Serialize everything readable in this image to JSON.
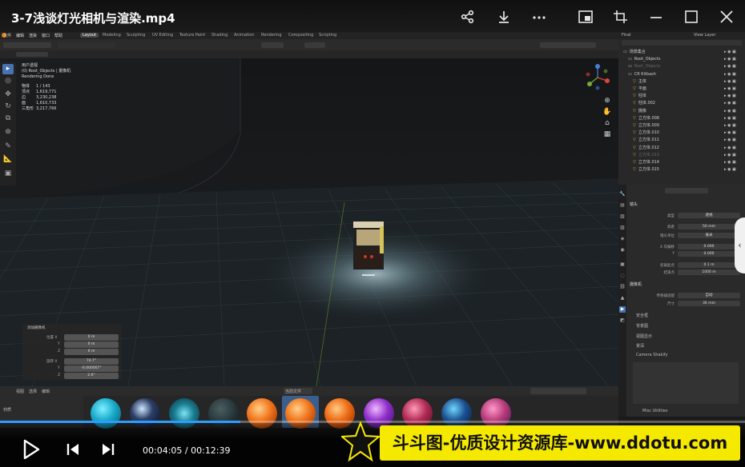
{
  "player": {
    "title": "3-7浅谈灯光相机与渲染.mp4",
    "time_current": "00:04:05",
    "time_total": "00:12:39",
    "time_separator": " / ",
    "progress": 0.323,
    "icons": [
      "share-icon",
      "download-icon",
      "more-icon",
      "picture-in-picture-icon",
      "crop-icon",
      "minimize-icon",
      "maximize-icon",
      "close-icon",
      "play-icon",
      "prev-icon",
      "next-icon"
    ]
  },
  "watermark": {
    "text": "斗斗图-优质设计资源库-www.ddotu.com"
  },
  "blender": {
    "menu": [
      "文件",
      "编辑",
      "渲染",
      "窗口",
      "帮助"
    ],
    "workspaces": [
      "Layout",
      "Modeling",
      "Sculpting",
      "UV Editing",
      "Texture Paint",
      "Shading",
      "Animation",
      "Rendering",
      "Compositing",
      "Scripting"
    ],
    "scene": "Final",
    "view_layer": "View Layer",
    "viewport_stats": {
      "view": "用户透视",
      "collection": "(0) Root_Objects | 摄像机",
      "status": "Rendering Done",
      "rows": [
        {
          "label": "物体",
          "value": "1 / 143"
        },
        {
          "label": "顶点",
          "value": "1,619,771"
        },
        {
          "label": "边",
          "value": "3,230,238"
        },
        {
          "label": "面",
          "value": "1,610,733"
        },
        {
          "label": "三角形",
          "value": "3,217,766"
        }
      ]
    },
    "redo_panel": {
      "title": "添加摄像机",
      "rows": [
        {
          "label": "位置 X",
          "value": "0 m"
        },
        {
          "label": "Y",
          "value": "0 m"
        },
        {
          "label": "Z",
          "value": "0 m"
        },
        {
          "label": "旋转 X",
          "value": "74.7°"
        },
        {
          "label": "Y",
          "value": "-0.000007°"
        },
        {
          "label": "Z",
          "value": "2.6°"
        }
      ]
    },
    "outliner": {
      "rows": [
        {
          "name": "场景集合",
          "dim": false
        },
        {
          "name": "Root_Objects",
          "dim": false
        },
        {
          "name": "Root_Objects",
          "dim": true
        },
        {
          "name": "CR Kitbash",
          "dim": false
        },
        {
          "name": "主体",
          "dim": false
        },
        {
          "name": "平面",
          "dim": false
        },
        {
          "name": "柱体",
          "dim": false
        },
        {
          "name": "柱体.002",
          "dim": false
        },
        {
          "name": "摄像",
          "dim": false
        },
        {
          "name": "立方体.008",
          "dim": false
        },
        {
          "name": "立方体.009",
          "dim": false
        },
        {
          "name": "立方体.010",
          "dim": false
        },
        {
          "name": "立方体.011",
          "dim": false
        },
        {
          "name": "立方体.012",
          "dim": false
        },
        {
          "name": "立方体.013",
          "dim": true
        },
        {
          "name": "立方体.014",
          "dim": false
        },
        {
          "name": "立方体.015",
          "dim": false
        }
      ]
    },
    "properties": {
      "section_lens": "镜头",
      "fields": [
        {
          "label": "类型",
          "value": "透视"
        },
        {
          "label": "焦距",
          "value": "50 mm"
        },
        {
          "label": "镜头单位",
          "value": "毫米"
        },
        {
          "label": "X 向偏移",
          "value": "0.000"
        },
        {
          "label": "Y",
          "value": "0.000"
        },
        {
          "label": "剪裁起点",
          "value": "0.1 m"
        },
        {
          "label": "结束点",
          "value": "1000 m"
        }
      ],
      "section_camera": "摄像机",
      "camera_fields": [
        {
          "label": "传感器适配",
          "value": "自动"
        },
        {
          "label": "尺寸",
          "value": "36 mm"
        }
      ],
      "subsections": [
        "安全框",
        "背景图",
        "视图显示",
        "景深",
        "Camera Shakify"
      ],
      "bottom": "Misc Utilities"
    },
    "asset_bar": {
      "items": [
        "视图",
        "选择",
        "编辑"
      ],
      "library": "当前文件",
      "category": "材质"
    }
  }
}
